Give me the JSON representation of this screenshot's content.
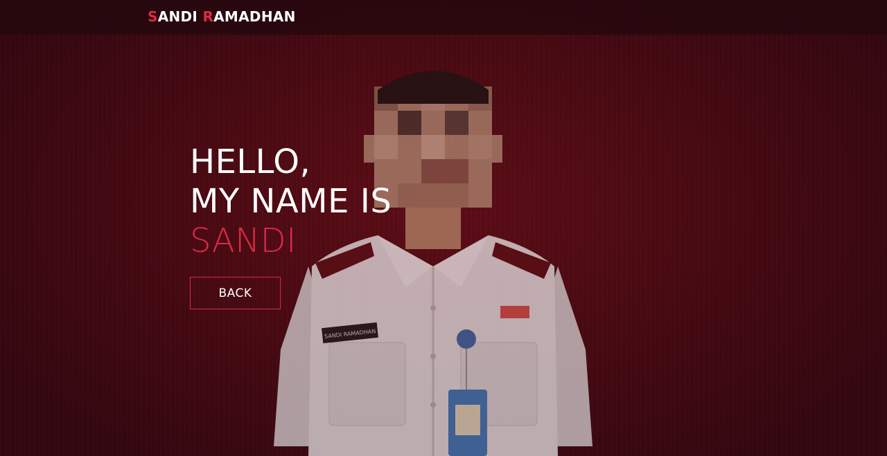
{
  "navbar": {
    "brand_first_initial": "S",
    "brand_first_rest": "ANDI ",
    "brand_last_initial": "R",
    "brand_last_rest": "AMADHAN"
  },
  "hero": {
    "line1": "HELLO,",
    "line2": "MY NAME IS",
    "name": "SANDI",
    "back_label": "BACK",
    "name_tag": "SANDI RAMADHAN"
  },
  "colors": {
    "accent": "#dc2a45",
    "background": "#4a0a12",
    "navbar": "#23080e",
    "text": "#ffffff"
  }
}
